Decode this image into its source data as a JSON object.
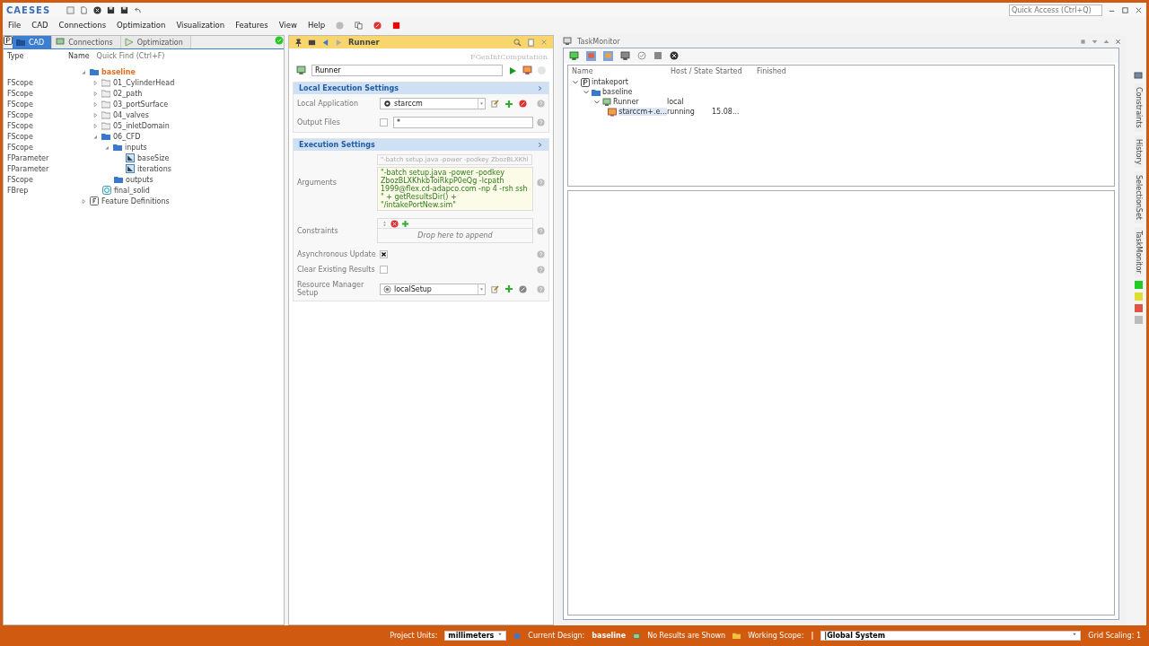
{
  "app": {
    "logo": "CAESES",
    "quick_access": {
      "placeholder": "Quick Access (Ctrl+Q)"
    }
  },
  "menu": [
    "File",
    "CAD",
    "Connections",
    "Optimization",
    "Visualization",
    "Features",
    "View",
    "Help"
  ],
  "left_panel": {
    "tabs": [
      {
        "label": "CAD",
        "selected": true
      },
      {
        "label": "Connections",
        "selected": false
      },
      {
        "label": "Optimization",
        "selected": false
      }
    ],
    "columns": [
      "Type",
      "Name"
    ],
    "quick_find": {
      "placeholder": "Quick Find (Ctrl+F)"
    },
    "tree": [
      {
        "name": "baseline",
        "kind": "folder",
        "current": true,
        "expanded": true,
        "children": [
          {
            "type": "FScope",
            "name": "01_CylinderHead",
            "kind": "folder-grey",
            "expanded": false
          },
          {
            "type": "FScope",
            "name": "02_path",
            "kind": "folder-grey",
            "expanded": false
          },
          {
            "type": "FScope",
            "name": "03_portSurface",
            "kind": "folder-grey",
            "expanded": false
          },
          {
            "type": "FScope",
            "name": "04_valves",
            "kind": "folder-grey",
            "expanded": false
          },
          {
            "type": "FScope",
            "name": "05_inletDomain",
            "kind": "folder-grey",
            "expanded": false
          },
          {
            "type": "FScope",
            "name": "06_CFD",
            "kind": "folder",
            "expanded": true,
            "children": [
              {
                "type": "FScope",
                "name": "inputs",
                "kind": "folder",
                "expanded": true,
                "children": [
                  {
                    "type": "FParameter",
                    "name": "baseSize",
                    "kind": "parameter"
                  },
                  {
                    "type": "FParameter",
                    "name": "iterations",
                    "kind": "parameter"
                  }
                ]
              },
              {
                "type": "FScope",
                "name": "outputs",
                "kind": "folder"
              }
            ]
          },
          {
            "type": "FBrep",
            "name": "final_solid",
            "kind": "brep"
          }
        ]
      },
      {
        "name": "Feature Definitions",
        "kind": "definitions",
        "expanded": false
      }
    ]
  },
  "editor": {
    "title": "Runner",
    "class_name": "FGenIntComputation",
    "name_value": "Runner",
    "sections": [
      {
        "title": "Local Execution Settings",
        "rows": [
          {
            "kind": "app-combo",
            "label": "Local Application",
            "value": "starccm"
          },
          {
            "kind": "check-text",
            "label": "Output Files",
            "checked": false,
            "value": "*"
          }
        ]
      },
      {
        "title": "Execution Settings",
        "rows": [
          {
            "kind": "arguments",
            "label": "Arguments",
            "preview": "\"-batch setup.java -power -podkey ZbozBLXKhl",
            "value": "\"-batch setup.java -power -podkey ZbozBLXKhkbToiRkpP0eQg -lcpath 1999@flex.cd-adapco.com -np 4 -rsh ssh \" + getResultsDir() + \"/intakePortNew.sim\""
          },
          {
            "kind": "list",
            "label": "Constraints",
            "drop_hint": "Drop here to append"
          },
          {
            "kind": "check",
            "label": "Asynchronous Update",
            "checked": true
          },
          {
            "kind": "check",
            "label": "Clear Existing Results",
            "checked": false
          },
          {
            "kind": "setup-combo",
            "label": "Resource Manager Setup",
            "value": "localSetup"
          }
        ]
      }
    ]
  },
  "task_monitor": {
    "title": "TaskMonitor",
    "columns": [
      "Name",
      "Host / State",
      "Started",
      "Finished"
    ],
    "tree": [
      {
        "name": "intakeport",
        "kind": "project",
        "expanded": true,
        "selected": false,
        "children": [
          {
            "name": "baseline",
            "kind": "folder",
            "expanded": true,
            "selected": false,
            "children": [
              {
                "name": "Runner",
                "kind": "computation",
                "expanded": true,
                "selected": false,
                "host_state": "local",
                "children": [
                  {
                    "name": "starccm+.e...",
                    "kind": "process",
                    "selected": true,
                    "host_state": "running",
                    "started": "15.08..."
                  }
                ]
              }
            ]
          }
        ]
      }
    ]
  },
  "side_tabs": [
    "Constraints",
    "History",
    "SelectionSet",
    "TaskMonitor"
  ],
  "status_bar": {
    "units_label": "Project Units:",
    "units": "millimeters",
    "design_label": "Current Design:",
    "design": "baseline",
    "results": "No Results are Shown",
    "scope_label": "Working Scope:",
    "scope": "|",
    "system": "|Global System",
    "grid": "Grid Scaling: 1"
  }
}
